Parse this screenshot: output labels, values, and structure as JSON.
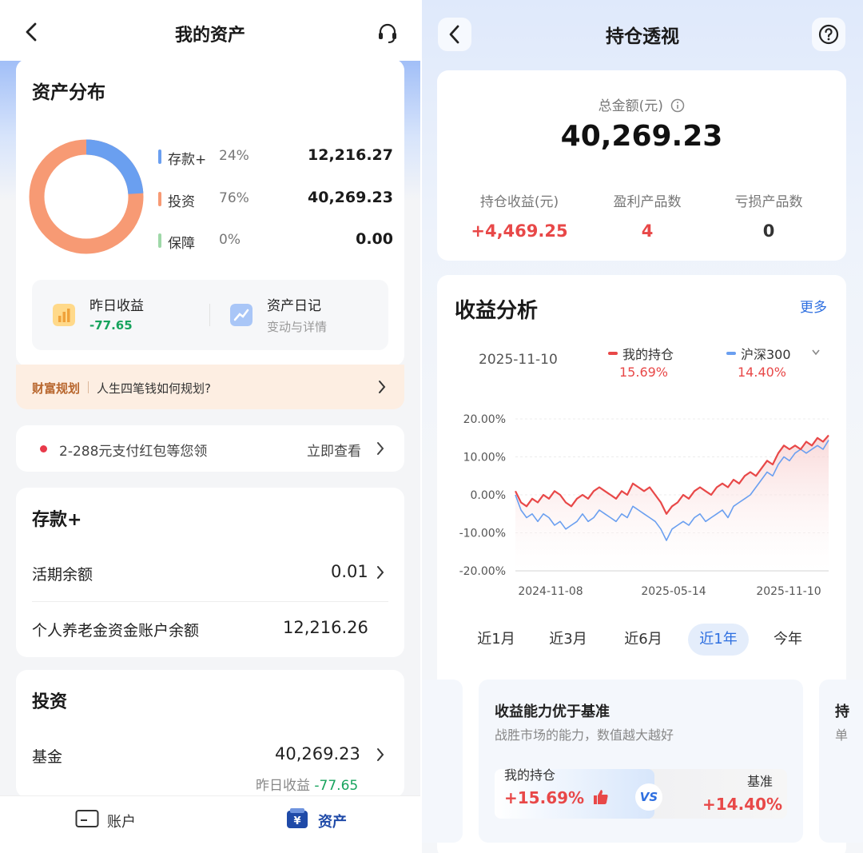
{
  "left": {
    "header": {
      "title": "我的资产"
    },
    "distribution": {
      "title": "资产分布",
      "items": [
        {
          "name": "存款+",
          "pct": "24%",
          "value": "12,216.27",
          "share": 24,
          "color": "#6a9ff0"
        },
        {
          "name": "投资",
          "pct": "76%",
          "value": "40,269.23",
          "share": 76,
          "color": "#f79a74"
        },
        {
          "name": "保障",
          "pct": "0%",
          "value": "0.00",
          "share": 0,
          "color": "#9fd8a8"
        }
      ],
      "yesterday": {
        "label": "昨日收益",
        "value": "-77.65"
      },
      "diary": {
        "label": "资产日记",
        "sub": "变动与详情"
      }
    },
    "plan": {
      "tag": "财富规划",
      "text": "人生四笔钱如何规划?"
    },
    "promo": {
      "text": "2-288元支付红包等您领",
      "link": "立即查看"
    },
    "deposit": {
      "title": "存款+",
      "rows": [
        {
          "label": "活期余额",
          "value": "0.01"
        },
        {
          "label": "个人养老金资金账户余额",
          "value": "12,216.26"
        }
      ]
    },
    "invest": {
      "title": "投资",
      "row": {
        "label": "基金",
        "value": "40,269.23"
      },
      "yesterday_label": "昨日收益",
      "yesterday_value": "-77.65"
    },
    "tabbar": {
      "account": "账户",
      "assets": "资产"
    }
  },
  "right": {
    "header": {
      "title": "持仓透视"
    },
    "summary": {
      "total_label": "总金额(元)",
      "total_value": "40,269.23",
      "stats": [
        {
          "label": "持仓收益(元)",
          "value": "+4,469.25",
          "color": "#e84848"
        },
        {
          "label": "盈利产品数",
          "value": "4",
          "color": "#e84848"
        },
        {
          "label": "亏损产品数",
          "value": "0",
          "color": "#333333"
        }
      ]
    },
    "analysis": {
      "title": "收益分析",
      "more": "更多",
      "date": "2025-11-10",
      "legend": [
        {
          "name": "我的持仓",
          "value": "15.69%",
          "color": "#e84848"
        },
        {
          "name": "沪深300",
          "value": "14.40%",
          "color": "#6a9ff0"
        }
      ],
      "ranges": [
        "近1月",
        "近3月",
        "近6月",
        "近1年",
        "今年"
      ],
      "active_range": 3
    },
    "compare": {
      "title": "收益能力优于基准",
      "sub": "战胜市场的能力，数值越大越好",
      "my_label": "我的持仓",
      "my_value": "+15.69%",
      "vs": "VS",
      "bm_label": "基准",
      "bm_value": "+14.40%",
      "side_glyph": "持",
      "side_glyph2": "单"
    }
  },
  "chart_data": {
    "type": "line",
    "x_ticks": [
      "2024-11-08",
      "2025-05-14",
      "2025-11-10"
    ],
    "y_ticks": [
      "20.00%",
      "10.00%",
      "0.00%",
      "-10.00%",
      "-20.00%"
    ],
    "ylim": [
      -20,
      20
    ],
    "grid": true,
    "series": [
      {
        "name": "我的持仓",
        "color": "#e84848",
        "values": [
          1,
          -2,
          -3,
          -1,
          -2,
          0,
          -1,
          1,
          0,
          -2,
          -3,
          -1,
          0,
          -1,
          1,
          2,
          1,
          0,
          -1,
          1,
          0,
          3,
          2,
          1,
          2,
          0,
          -2,
          -5,
          -3,
          -2,
          0,
          -1,
          1,
          2,
          1,
          0,
          2,
          3,
          2,
          4,
          3,
          5,
          6,
          5,
          7,
          9,
          8,
          11,
          13,
          12,
          13,
          12,
          14,
          13,
          15,
          14,
          15.69
        ]
      },
      {
        "name": "沪深300",
        "color": "#6a9ff0",
        "values": [
          0,
          -4,
          -6,
          -5,
          -7,
          -5,
          -6,
          -8,
          -7,
          -9,
          -8,
          -7,
          -5,
          -7,
          -6,
          -4,
          -5,
          -6,
          -7,
          -5,
          -6,
          -3,
          -4,
          -5,
          -6,
          -7,
          -9,
          -12,
          -9,
          -8,
          -7,
          -8,
          -6,
          -5,
          -7,
          -6,
          -5,
          -4,
          -6,
          -3,
          -2,
          -1,
          0,
          2,
          4,
          6,
          5,
          8,
          10,
          9,
          11,
          12,
          11,
          12,
          13,
          12,
          14.4
        ]
      }
    ]
  }
}
